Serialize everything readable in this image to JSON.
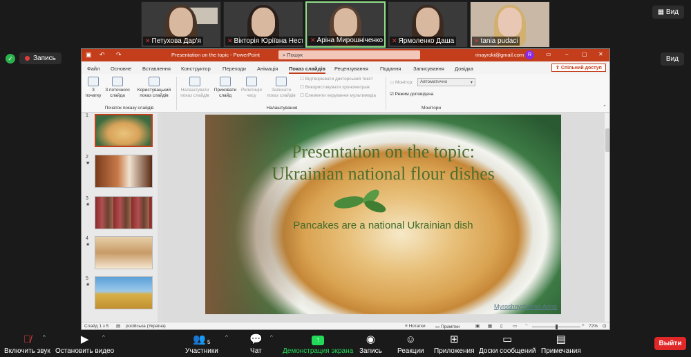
{
  "zoom": {
    "top_right_view": "Вид",
    "record_label": "Запись",
    "participants": [
      {
        "name": "Петухова Дар'я",
        "muted": true
      },
      {
        "name": "Вікторія Юріївна Несте...",
        "muted": true
      },
      {
        "name": "Аріна Мирошніченко",
        "muted": true
      },
      {
        "name": "Ярмоленко Даша",
        "muted": true
      },
      {
        "name": "tania pudaci",
        "muted": true
      }
    ],
    "toolbar": {
      "unmute": "Включить звук",
      "video": "Остановить видео",
      "participants": "Участники",
      "participants_count": "5",
      "chat": "Чат",
      "share": "Демонстрация экрана",
      "record": "Запись",
      "reactions": "Реакции",
      "apps": "Приложения",
      "whiteboards": "Доски сообщений",
      "notes": "Примечания",
      "leave": "Выйти"
    },
    "share_view": "Вид"
  },
  "ppt": {
    "title": "Presentation on the topic - PowerPoint",
    "search": "Пошук",
    "account": "rinayroki@gmail.com",
    "avatar": "R",
    "share_btn": "Спільний доступ",
    "tabs": [
      "Файл",
      "Основне",
      "Вставлення",
      "Конструктор",
      "Переходи",
      "Анімація",
      "Показ слайдів",
      "Рецензування",
      "Подання",
      "Записування",
      "Довідка"
    ],
    "ribbon": {
      "from_start": "З початку",
      "from_current": "З поточного слайда",
      "custom_show": "Користувацький показ слайдів",
      "group1": "Початок показу слайдів",
      "setup": "Налаштувати показ слайдів",
      "hide": "Приховати слайд",
      "rehearse": "Репетиція часу",
      "record": "Записати показ слайдів",
      "chk_narration": "Відтворювати дикторський текст",
      "chk_timings": "Використовувати хронометраж",
      "chk_media": "Елементи керування мультимедіа",
      "group2": "Налаштування",
      "monitor_label": "Монітор:",
      "monitor_value": "Автоматично",
      "presenter": "Режим доповідача",
      "group3": "Монітори"
    },
    "slide": {
      "title1": "Presentation on the topic:",
      "title2": "Ukrainian national flour dishes",
      "subtitle": "Pancakes are a national Ukrainian dish",
      "author": "Myroshnychenko Arina"
    },
    "thumb_nums": [
      "1",
      "2",
      "3",
      "4",
      "5"
    ],
    "status": {
      "slide": "Слайд 1 з 5",
      "lang": "російська (Україна)",
      "notes": "Нотатки",
      "comments": "Примітки",
      "zoom": "72%"
    }
  },
  "colors": {
    "accent": "#c43e1c",
    "zoom_share": "#23d959",
    "leave": "#e02828"
  }
}
